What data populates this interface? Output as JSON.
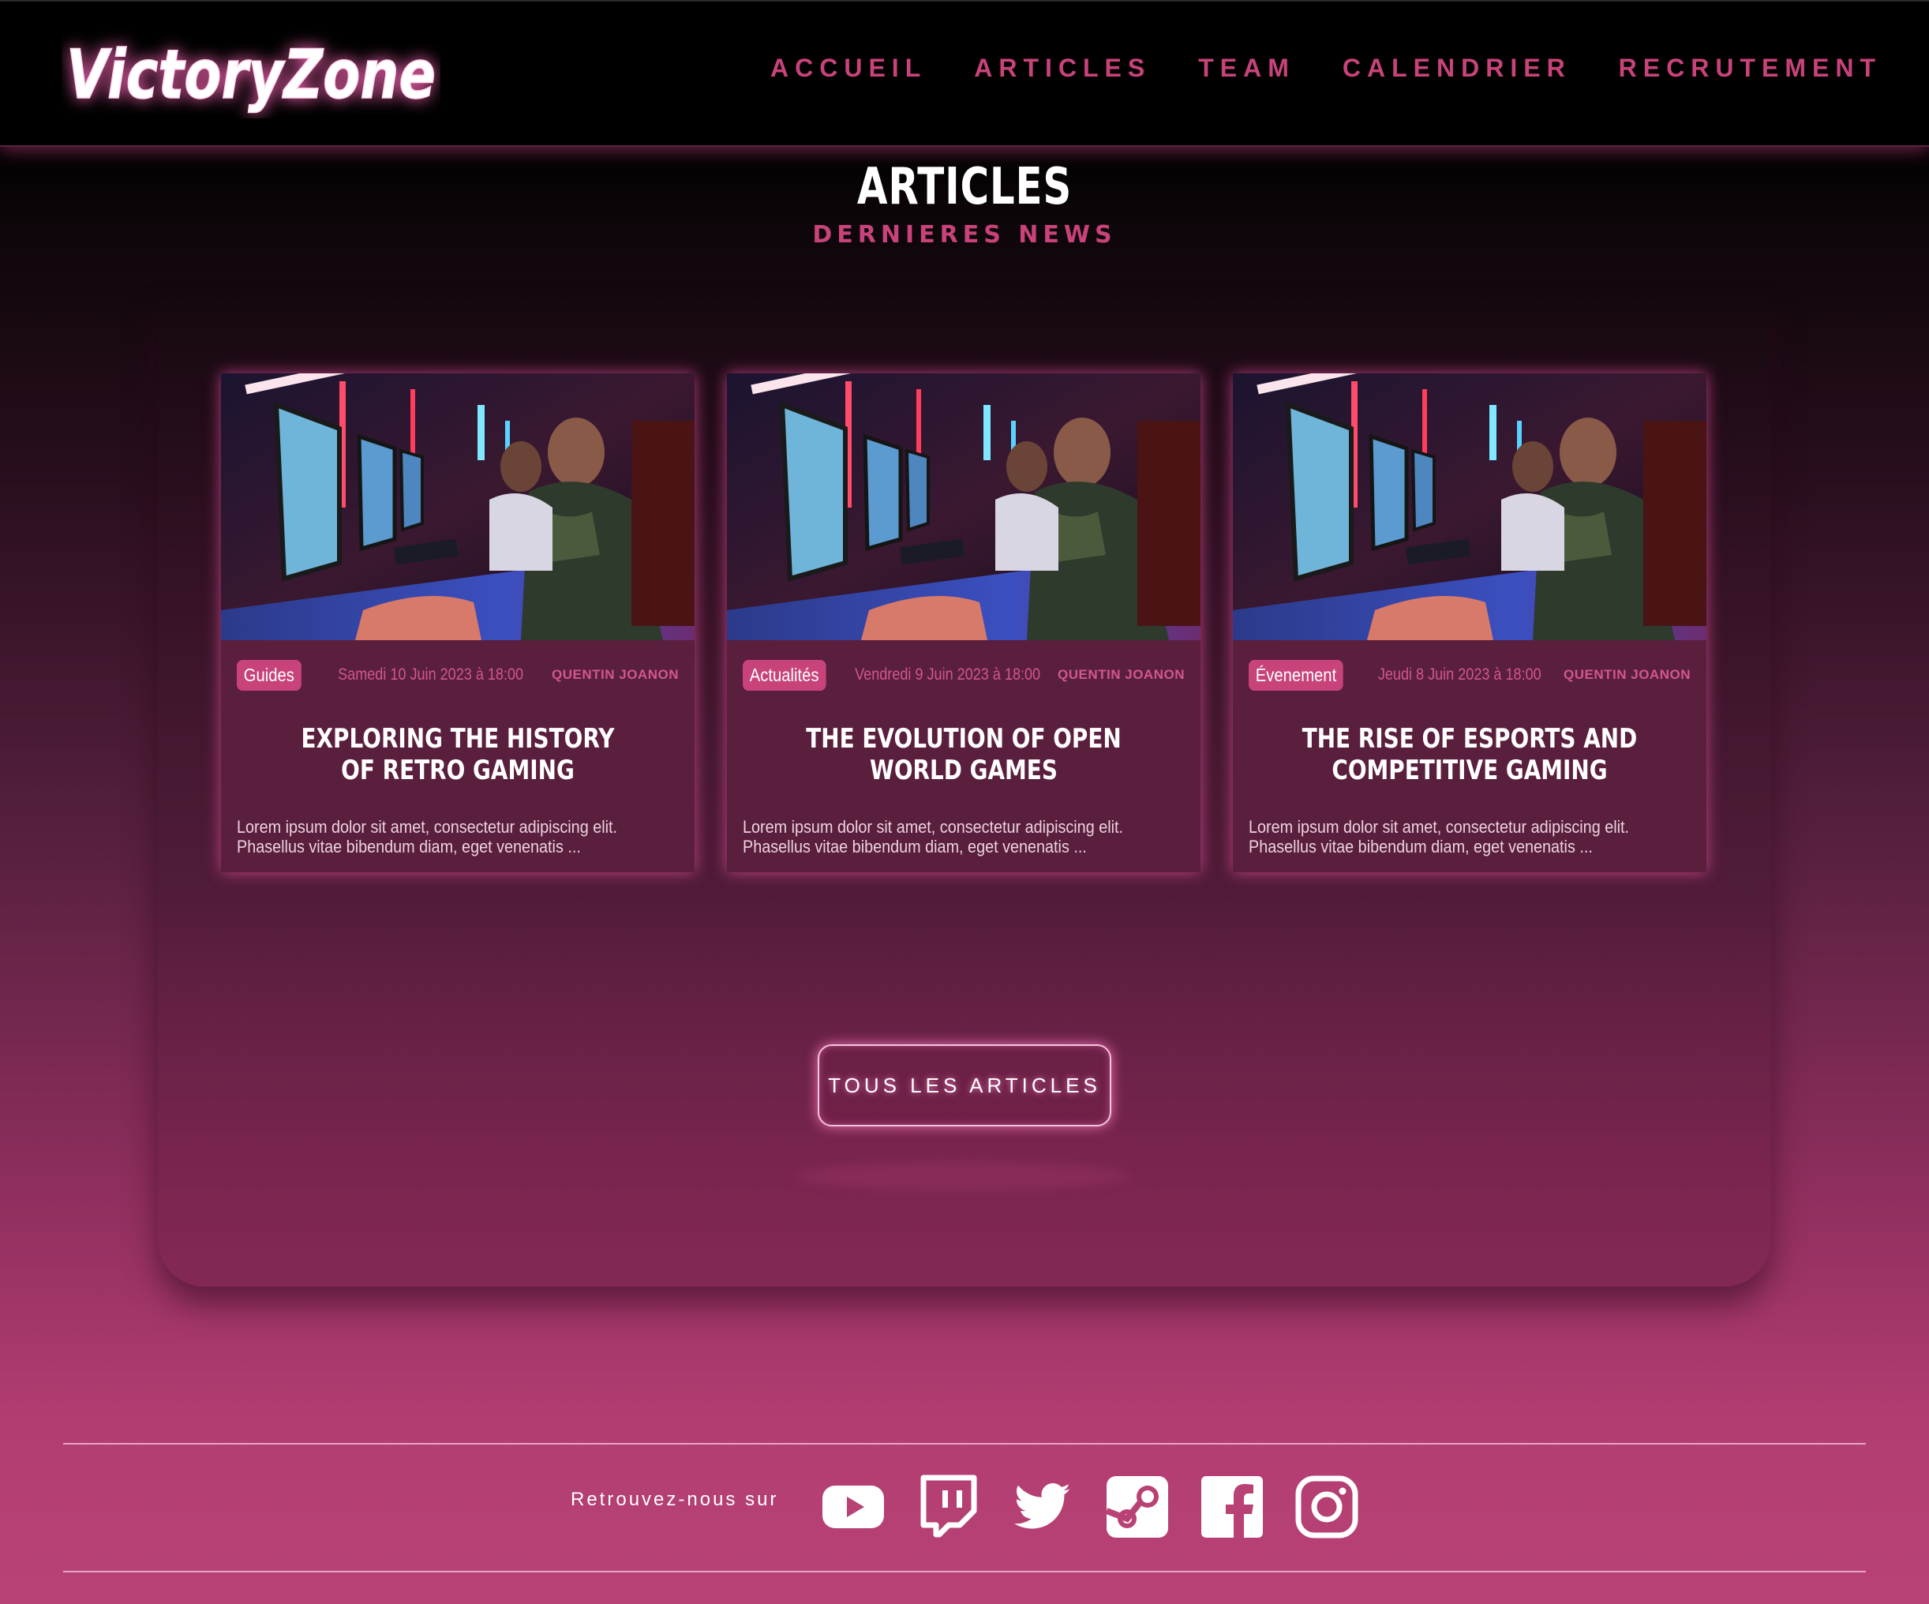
{
  "header": {
    "logo_text": "VictoryZone",
    "nav": [
      "ACCUEIL",
      "ARTICLES",
      "TEAM",
      "CALENDRIER",
      "RECRUTEMENT"
    ]
  },
  "section": {
    "title": "ARTICLES",
    "subtitle": "DERNIERES NEWS"
  },
  "articles": [
    {
      "tag": "Guides",
      "date": "Samedi 10 Juin 2023 à 18:00",
      "author": "QUENTIN JOANON",
      "title": "EXPLORING THE HISTORY OF RETRO GAMING",
      "excerpt": "Lorem ipsum dolor sit amet, consectetur adipiscing elit. Phasellus vitae bibendum diam, eget venenatis ..."
    },
    {
      "tag": "Actualités",
      "date": "Vendredi 9 Juin 2023 à 18:00",
      "author": "QUENTIN JOANON",
      "title": "THE EVOLUTION OF OPEN WORLD GAMES",
      "excerpt": "Lorem ipsum dolor sit amet, consectetur adipiscing elit. Phasellus vitae bibendum diam, eget venenatis ..."
    },
    {
      "tag": "Évenement",
      "date": "Jeudi 8 Juin 2023 à 18:00",
      "author": "QUENTIN JOANON",
      "title": "THE RISE OF ESPORTS AND COMPETITIVE GAMING",
      "excerpt": "Lorem ipsum dolor sit amet, consectetur adipiscing elit. Phasellus vitae bibendum diam, eget venenatis ..."
    }
  ],
  "all_articles_button": "TOUS LES ARTICLES",
  "footer": {
    "follow_label": "Retrouvez-nous sur",
    "socials": [
      "youtube-icon",
      "twitch-icon",
      "twitter-icon",
      "steam-icon",
      "facebook-icon",
      "instagram-icon"
    ]
  },
  "colors": {
    "accent": "#c8437a",
    "header_bg": "#000000",
    "card_bg": "#5a1f3d",
    "footer_bg": "#b84274"
  }
}
